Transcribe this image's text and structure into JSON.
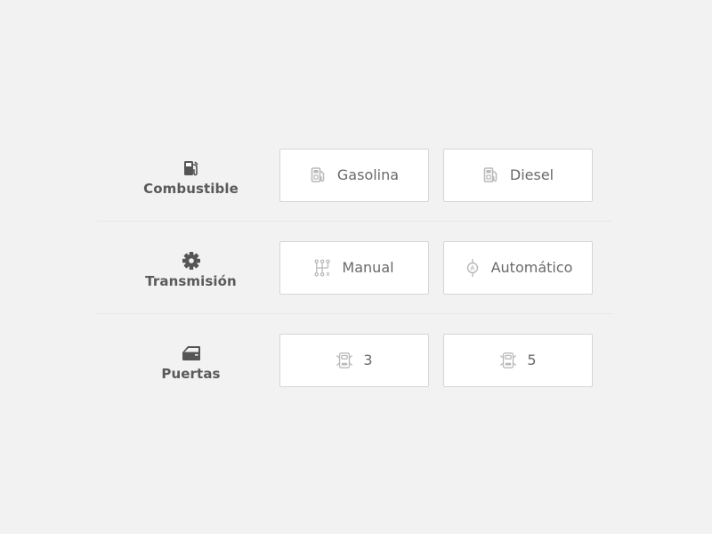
{
  "rows": [
    {
      "label": "Combustible",
      "icon": "fuel-pump-icon",
      "options": [
        {
          "label": "Gasolina",
          "icon": "fuel-pump-icon"
        },
        {
          "label": "Diesel",
          "icon": "fuel-pump-icon"
        }
      ]
    },
    {
      "label": "Transmisión",
      "icon": "gear-icon",
      "options": [
        {
          "label": "Manual",
          "icon": "manual-shifter-icon"
        },
        {
          "label": "Automático",
          "icon": "automatic-shifter-icon"
        }
      ]
    },
    {
      "label": "Puertas",
      "icon": "car-door-icon",
      "options": [
        {
          "label": "3",
          "icon": "car-doors-icon"
        },
        {
          "label": "5",
          "icon": "car-doors-icon"
        }
      ]
    }
  ],
  "colors": {
    "background": "#f2f2f2",
    "label_icon": "#555555",
    "option_icon": "#b9b9b9",
    "option_border": "#d6d6d6"
  }
}
